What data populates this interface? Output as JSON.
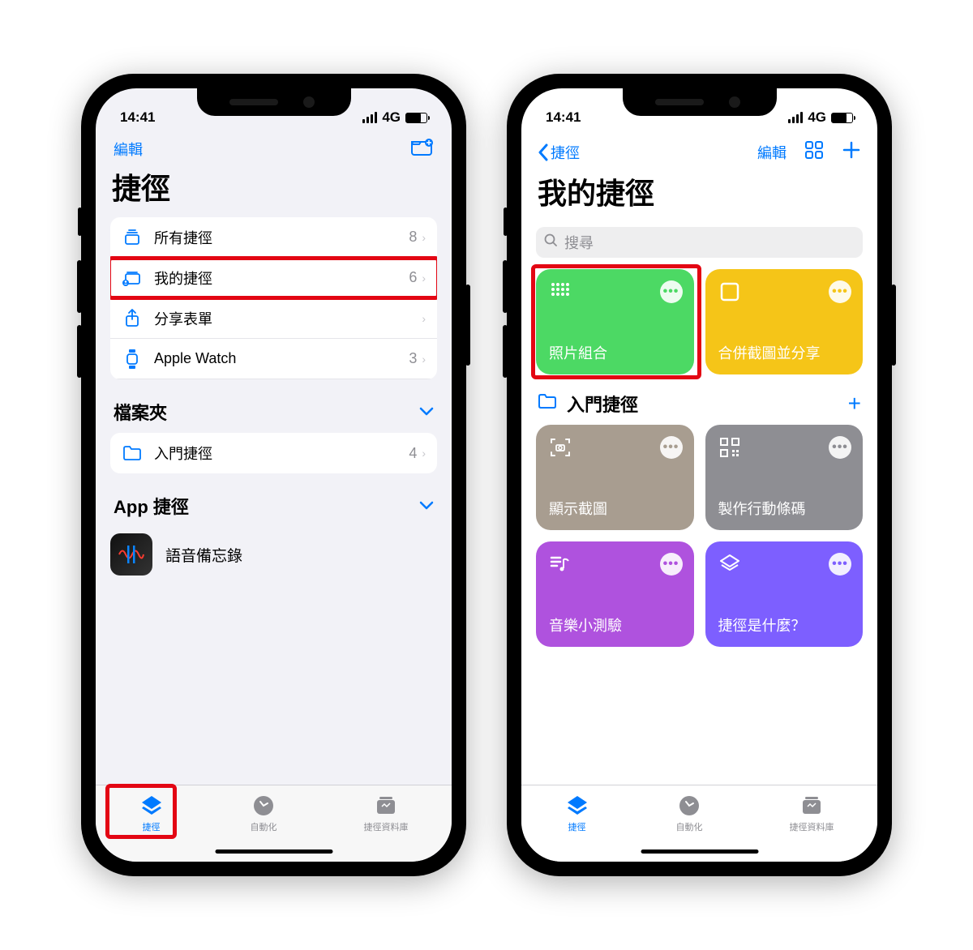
{
  "status": {
    "time": "14:41",
    "network": "4G"
  },
  "p1": {
    "nav": {
      "edit": "編輯"
    },
    "title": "捷徑",
    "rows": [
      {
        "label": "所有捷徑",
        "count": "8"
      },
      {
        "label": "我的捷徑",
        "count": "6"
      },
      {
        "label": "分享表單",
        "count": ""
      },
      {
        "label": "Apple Watch",
        "count": "3"
      }
    ],
    "folders": {
      "title": "檔案夾",
      "rows": [
        {
          "label": "入門捷徑",
          "count": "4"
        }
      ]
    },
    "apps": {
      "title": "App 捷徑",
      "rows": [
        {
          "label": "語音備忘錄"
        }
      ]
    }
  },
  "p2": {
    "nav": {
      "back": "捷徑",
      "edit": "編輯"
    },
    "title": "我的捷徑",
    "search": "搜尋",
    "my": [
      {
        "name": "照片組合",
        "color": "c-green"
      },
      {
        "name": "合併截圖並分享",
        "color": "c-yellow"
      }
    ],
    "starter": {
      "title": "入門捷徑",
      "cards": [
        {
          "name": "顯示截圖",
          "color": "c-tan"
        },
        {
          "name": "製作行動條碼",
          "color": "c-gray"
        },
        {
          "name": "音樂小測驗",
          "color": "c-purple"
        },
        {
          "name": "捷徑是什麼？",
          "color": "c-violet"
        }
      ]
    }
  },
  "tabs": [
    {
      "label": "捷徑"
    },
    {
      "label": "自動化"
    },
    {
      "label": "捷徑資料庫"
    }
  ]
}
